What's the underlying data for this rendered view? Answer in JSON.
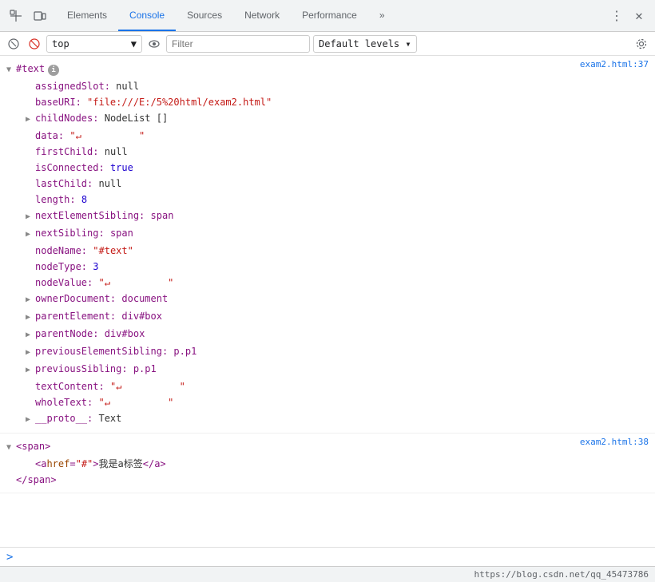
{
  "tabs": [
    {
      "label": "Elements",
      "active": false
    },
    {
      "label": "Console",
      "active": true
    },
    {
      "label": "Sources",
      "active": false
    },
    {
      "label": "Network",
      "active": false
    },
    {
      "label": "Performance",
      "active": false
    },
    {
      "label": "»",
      "active": false
    }
  ],
  "toolbar": {
    "more_label": "⋮",
    "close_label": "✕"
  },
  "console_bar": {
    "context_value": "top",
    "filter_placeholder": "Filter",
    "levels_label": "Default levels ▾"
  },
  "entry1": {
    "file_ref": "exam2.html:37",
    "header_label": "#text",
    "rows": [
      {
        "indent": 1,
        "key": "assignedSlot:",
        "val": "null",
        "val_type": "null",
        "has_arrow": false
      },
      {
        "indent": 1,
        "key": "baseURI:",
        "val": "\"file:///E:/5%20html/exam2.html\"",
        "val_type": "string",
        "has_arrow": false
      },
      {
        "indent": 1,
        "key": "childNodes:",
        "val": "NodeList []",
        "val_type": "obj",
        "has_arrow": true
      },
      {
        "indent": 1,
        "key": "data:",
        "val": "\"↵          \"",
        "val_type": "string",
        "has_arrow": false
      },
      {
        "indent": 1,
        "key": "firstChild:",
        "val": "null",
        "val_type": "null",
        "has_arrow": false
      },
      {
        "indent": 1,
        "key": "isConnected:",
        "val": "true",
        "val_type": "bool",
        "has_arrow": false
      },
      {
        "indent": 1,
        "key": "lastChild:",
        "val": "null",
        "val_type": "null",
        "has_arrow": false
      },
      {
        "indent": 1,
        "key": "length:",
        "val": "8",
        "val_type": "number",
        "has_arrow": false
      },
      {
        "indent": 1,
        "key": "nextElementSibling:",
        "val": "span",
        "val_type": "link",
        "has_arrow": true
      },
      {
        "indent": 1,
        "key": "nextSibling:",
        "val": "span",
        "val_type": "link",
        "has_arrow": true
      },
      {
        "indent": 1,
        "key": "nodeName:",
        "val": "\"#text\"",
        "val_type": "string",
        "has_arrow": false
      },
      {
        "indent": 1,
        "key": "nodeType:",
        "val": "3",
        "val_type": "number",
        "has_arrow": false
      },
      {
        "indent": 1,
        "key": "nodeValue:",
        "val": "\"↵          \"",
        "val_type": "string",
        "has_arrow": false
      },
      {
        "indent": 1,
        "key": "ownerDocument:",
        "val": "document",
        "val_type": "link",
        "has_arrow": true
      },
      {
        "indent": 1,
        "key": "parentElement:",
        "val": "div#box",
        "val_type": "link",
        "has_arrow": true
      },
      {
        "indent": 1,
        "key": "parentNode:",
        "val": "div#box",
        "val_type": "link",
        "has_arrow": true
      },
      {
        "indent": 1,
        "key": "previousElementSibling:",
        "val": "p.p1",
        "val_type": "link",
        "has_arrow": true
      },
      {
        "indent": 1,
        "key": "previousSibling:",
        "val": "p.p1",
        "val_type": "link",
        "has_arrow": true
      },
      {
        "indent": 1,
        "key": "textContent:",
        "val": "\"↵          \"",
        "val_type": "string",
        "has_arrow": false
      },
      {
        "indent": 1,
        "key": "wholeText:",
        "val": "\"↵          \"",
        "val_type": "string",
        "has_arrow": false
      },
      {
        "indent": 1,
        "key": "__proto__:",
        "val": "Text",
        "val_type": "obj",
        "has_arrow": true
      }
    ]
  },
  "entry2": {
    "file_ref": "exam2.html:38",
    "span_open": "<span>",
    "span_a_open": "<a href=\"#\">",
    "span_a_text": "我是a标签",
    "span_a_close": "</a>",
    "span_close": "</span>"
  },
  "prompt": {
    "label": ">"
  },
  "status_bar": {
    "url": "https://blog.csdn.net/qq_45473786"
  }
}
